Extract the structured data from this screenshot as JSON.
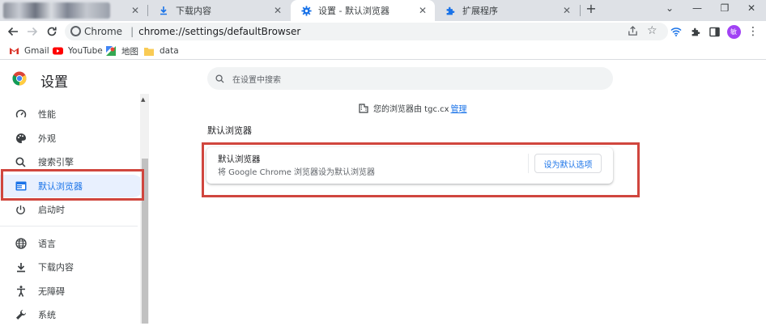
{
  "tabs": [
    {
      "title": "",
      "icon": "blurred-favicon"
    },
    {
      "title": "下载内容",
      "icon": "download-icon"
    },
    {
      "title": "设置 - 默认浏览器",
      "icon": "gear-icon",
      "active": true
    },
    {
      "title": "扩展程序",
      "icon": "puzzle-icon"
    }
  ],
  "toolbar": {
    "site_chip": "Chrome",
    "url": "chrome://settings/defaultBrowser",
    "profile_initial": "敏"
  },
  "bookmarks": [
    {
      "label": "Gmail",
      "icon": "gmail-icon"
    },
    {
      "label": "YouTube",
      "icon": "youtube-icon"
    },
    {
      "label": "地图",
      "icon": "maps-icon"
    },
    {
      "label": "data",
      "icon": "folder-icon"
    }
  ],
  "settings": {
    "title": "设置",
    "search_placeholder": "在设置中搜索"
  },
  "sidebar": {
    "items": [
      {
        "label": "性能",
        "icon": "speedometer-icon"
      },
      {
        "label": "外观",
        "icon": "palette-icon"
      },
      {
        "label": "搜索引擎",
        "icon": "search-icon"
      },
      {
        "label": "默认浏览器",
        "icon": "browser-icon",
        "active": true
      },
      {
        "label": "启动时",
        "icon": "power-icon"
      },
      {
        "label": "语言",
        "icon": "globe-icon"
      },
      {
        "label": "下载内容",
        "icon": "download-icon"
      },
      {
        "label": "无障碍",
        "icon": "accessibility-icon"
      },
      {
        "label": "系统",
        "icon": "wrench-icon"
      }
    ]
  },
  "main": {
    "managed_text": "您的浏览器由 tgc.cx",
    "managed_link": "管理",
    "section_title": "默认浏览器",
    "card_title": "默认浏览器",
    "card_subtitle": "将 Google Chrome 浏览器设为默认浏览器",
    "card_button": "设为默认选项"
  },
  "colors": {
    "accent": "#1a73e8",
    "highlight_box": "#d0463e",
    "active_nav_bg": "#e8f0fe",
    "profile_avatar": "#a142f4"
  }
}
